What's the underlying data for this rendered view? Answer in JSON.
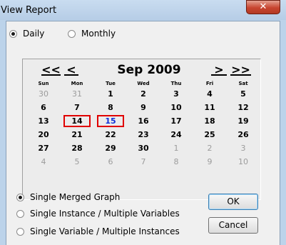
{
  "window": {
    "title": "View Report"
  },
  "period": {
    "daily_label": "Daily",
    "monthly_label": "Monthly",
    "selected": "daily"
  },
  "calendar": {
    "prev_year": "<<",
    "prev_month": "<",
    "next_month": ">",
    "next_year": ">>",
    "month_title": "Sep 2009",
    "weekdays": [
      "Sun",
      "Mon",
      "Tue",
      "Wed",
      "Thu",
      "Fri",
      "Sat"
    ],
    "weeks": [
      [
        "30",
        "31",
        "1",
        "2",
        "3",
        "4",
        "5"
      ],
      [
        "6",
        "7",
        "8",
        "9",
        "10",
        "11",
        "12"
      ],
      [
        "13",
        "14",
        "15",
        "16",
        "17",
        "18",
        "19"
      ],
      [
        "20",
        "21",
        "22",
        "23",
        "24",
        "25",
        "26"
      ],
      [
        "27",
        "28",
        "29",
        "30",
        "1",
        "2",
        "3"
      ],
      [
        "4",
        "5",
        "6",
        "7",
        "8",
        "9",
        "10"
      ]
    ],
    "selected_range": [
      "14",
      "15"
    ],
    "today": "15"
  },
  "graph_options": {
    "items": [
      "Single Merged Graph",
      "Single Instance / Multiple Variables",
      "Single Variable / Multiple Instances"
    ],
    "selected_index": 0
  },
  "buttons": {
    "ok": "OK",
    "cancel": "Cancel"
  }
}
